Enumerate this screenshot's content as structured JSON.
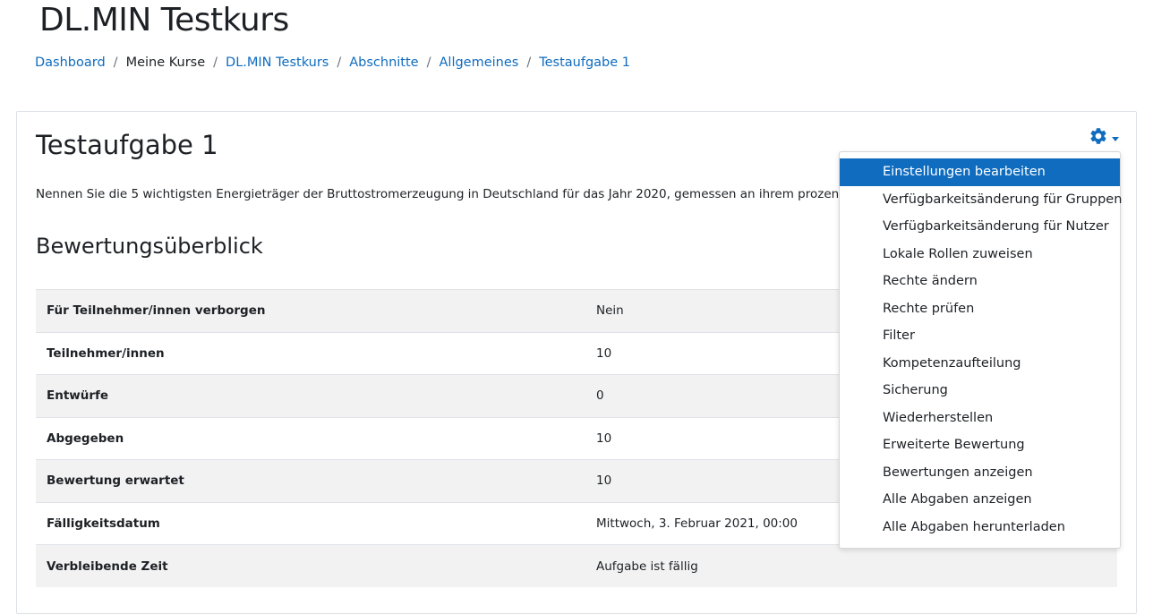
{
  "header": {
    "course_title": "DL.MIN Testkurs"
  },
  "breadcrumb": {
    "items": [
      {
        "label": "Dashboard",
        "link": true
      },
      {
        "label": "Meine Kurse",
        "link": false
      },
      {
        "label": "DL.MIN Testkurs",
        "link": true
      },
      {
        "label": "Abschnitte",
        "link": true
      },
      {
        "label": "Allgemeines",
        "link": true
      },
      {
        "label": "Testaufgabe 1",
        "link": true
      }
    ],
    "separator": "/"
  },
  "main": {
    "activity_title": "Testaufgabe 1",
    "intro": "Nennen Sie die 5 wichtigsten Energieträger der Bruttostromerzeugung in Deutschland für das Jahr 2020, gemessen an ihrem prozentualen A",
    "summary_heading": "Bewertungsüberblick",
    "summary_rows": [
      {
        "label": "Für Teilnehmer/innen verborgen",
        "value": "Nein"
      },
      {
        "label": "Teilnehmer/innen",
        "value": "10"
      },
      {
        "label": "Entwürfe",
        "value": "0"
      },
      {
        "label": "Abgegeben",
        "value": "10"
      },
      {
        "label": "Bewertung erwartet",
        "value": "10"
      },
      {
        "label": "Fälligkeitsdatum",
        "value": "Mittwoch, 3. Februar 2021, 00:00"
      },
      {
        "label": "Verbleibende Zeit",
        "value": "Aufgabe ist fällig"
      }
    ]
  },
  "actions_menu": {
    "icon": "gear-icon",
    "items": [
      {
        "label": "Einstellungen bearbeiten",
        "active": true
      },
      {
        "label": "Verfügbarkeitsänderung für Gruppen",
        "active": false
      },
      {
        "label": "Verfügbarkeitsänderung für Nutzer",
        "active": false
      },
      {
        "label": "Lokale Rollen zuweisen",
        "active": false
      },
      {
        "label": "Rechte ändern",
        "active": false
      },
      {
        "label": "Rechte prüfen",
        "active": false
      },
      {
        "label": "Filter",
        "active": false
      },
      {
        "label": "Kompetenzaufteilung",
        "active": false
      },
      {
        "label": "Sicherung",
        "active": false
      },
      {
        "label": "Wiederherstellen",
        "active": false
      },
      {
        "label": "Erweiterte Bewertung",
        "active": false
      },
      {
        "label": "Bewertungen anzeigen",
        "active": false
      },
      {
        "label": "Alle Abgaben anzeigen",
        "active": false
      },
      {
        "label": "Alle Abgaben herunterladen",
        "active": false
      }
    ]
  },
  "colors": {
    "link": "#0f6cbf",
    "active_bg": "#0f6cbf",
    "text": "#1d2125",
    "row_stripe": "#f2f2f2"
  }
}
